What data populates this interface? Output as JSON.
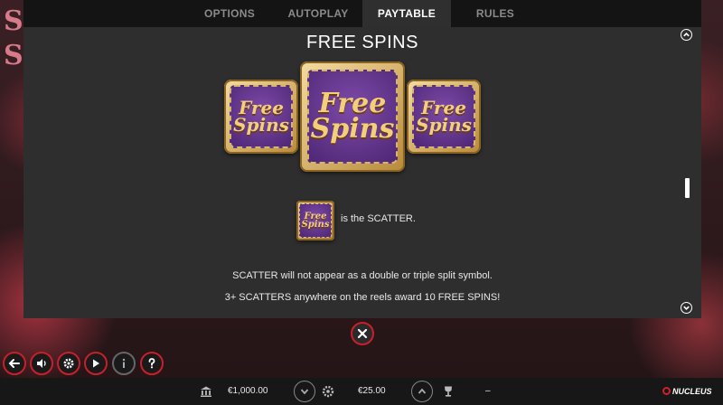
{
  "tabs": [
    {
      "label": "OPTIONS",
      "active": false
    },
    {
      "label": "AUTOPLAY",
      "active": false
    },
    {
      "label": "PAYTABLE",
      "active": true
    },
    {
      "label": "RULES",
      "active": false
    }
  ],
  "paytable": {
    "section_title": "FREE SPINS",
    "symbol_text": [
      "Free",
      "Spins"
    ],
    "scatter_label": "is the SCATTER.",
    "description_1": "SCATTER will not appear as a double or triple split symbol.",
    "description_2": "3+ SCATTERS anywhere on the reels award 10 FREE SPINS!"
  },
  "scroll": {
    "position_fraction": 0.45
  },
  "controls": [
    {
      "name": "back-button",
      "icon": "back-arrow-icon"
    },
    {
      "name": "sound-button",
      "icon": "speaker-icon"
    },
    {
      "name": "settings-button",
      "icon": "gear-icon"
    },
    {
      "name": "autoplay-button",
      "icon": "play-icon"
    },
    {
      "name": "info-button",
      "icon": "info-icon"
    },
    {
      "name": "help-button",
      "icon": "question-icon"
    }
  ],
  "bottom_bar": {
    "balance": "€1,000.00",
    "bet": "€25.00",
    "win": "–",
    "brand": "NUCLEUS"
  },
  "colors": {
    "accent": "#c8202a",
    "symbol_purple": "#5e2f8a",
    "symbol_gold": "#f3cf7a",
    "panel": "#2e2e2e"
  }
}
